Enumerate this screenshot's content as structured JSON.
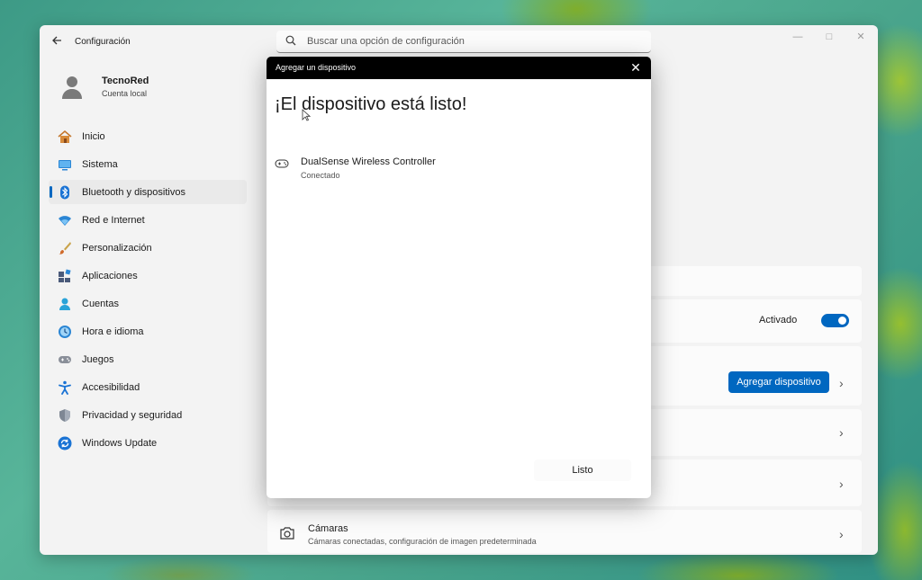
{
  "window": {
    "title": "Configuración",
    "search_placeholder": "Buscar una opción de configuración"
  },
  "profile": {
    "name": "TecnoRed",
    "account_type": "Cuenta local"
  },
  "nav": {
    "items": [
      {
        "label": "Inicio",
        "icon": "home-icon"
      },
      {
        "label": "Sistema",
        "icon": "system-icon"
      },
      {
        "label": "Bluetooth y dispositivos",
        "icon": "bluetooth-icon",
        "active": true
      },
      {
        "label": "Red e Internet",
        "icon": "wifi-icon"
      },
      {
        "label": "Personalización",
        "icon": "brush-icon"
      },
      {
        "label": "Aplicaciones",
        "icon": "apps-icon"
      },
      {
        "label": "Cuentas",
        "icon": "accounts-icon"
      },
      {
        "label": "Hora e idioma",
        "icon": "time-language-icon"
      },
      {
        "label": "Juegos",
        "icon": "gamepad-icon"
      },
      {
        "label": "Accesibilidad",
        "icon": "accessibility-icon"
      },
      {
        "label": "Privacidad y seguridad",
        "icon": "shield-icon"
      },
      {
        "label": "Windows Update",
        "icon": "update-icon"
      }
    ]
  },
  "main": {
    "bluetooth_status": "Activado",
    "bluetooth_on": true,
    "add_device_label": "Agregar dispositivo",
    "cameras": {
      "title": "Cámaras",
      "description": "Cámaras conectadas, configuración de imagen predeterminada"
    }
  },
  "dialog": {
    "title": "Agregar un dispositivo",
    "heading": "¡El dispositivo está listo!",
    "device": {
      "name": "DualSense Wireless Controller",
      "status": "Conectado"
    },
    "done_label": "Listo"
  },
  "colors": {
    "accent": "#0067c0",
    "dialog_titlebar": "#000000",
    "window_bg": "#f3f3f3"
  }
}
